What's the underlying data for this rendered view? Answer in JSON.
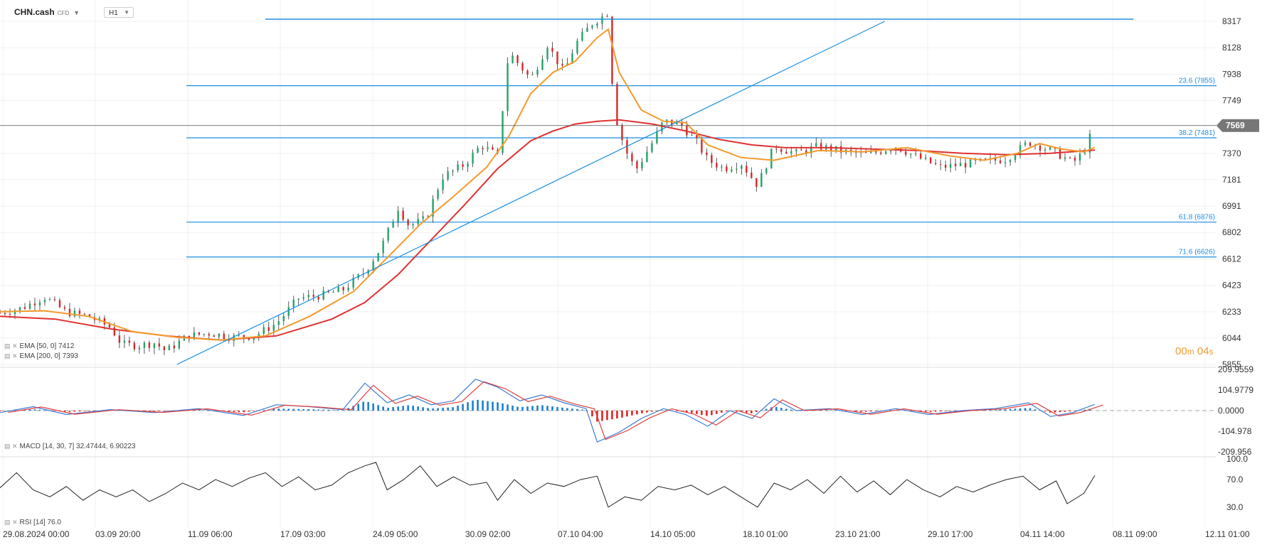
{
  "header": {
    "symbol": "CHN.cash",
    "symbol_type": "CFD",
    "timeframe": "H1"
  },
  "indicators": {
    "ema50_label": "EMA [50, 0] 7412",
    "ema200_label": "EMA [200, 0] 7393",
    "macd_label": "MACD [14, 30, 7] 32.47444, 6.90223",
    "rsi_label": "RSI [14] 76.0"
  },
  "timer": {
    "minutes": "00",
    "m": "m",
    "seconds": "04",
    "s": "s"
  },
  "colors": {
    "candle_up": "#26a269",
    "candle_down": "#d62828",
    "ema50": "#f39a2c",
    "ema200": "#e03131",
    "fib_line": "#1b8fe0",
    "macd_up": "#1b7fd1",
    "macd_down": "#e02525",
    "macd_line": "#3a7bd5",
    "signal_line": "#e04040",
    "rsi_line": "#222222",
    "price_tag": "#777777"
  },
  "chart_data": {
    "type": "candlestick",
    "current_price": 7569,
    "price_axis": {
      "ticks": [
        "8317",
        "8128",
        "7938",
        "7749",
        "7370",
        "7181",
        "6991",
        "6802",
        "6612",
        "6423",
        "6233",
        "6044",
        "5855"
      ],
      "range": [
        5855,
        8317
      ]
    },
    "time_axis": [
      "29.08.2024  00:00",
      "03.09  20:00",
      "11.09  06:00",
      "17.09  03:00",
      "24.09  05:00",
      "30.09  02:00",
      "07.10  04:00",
      "14.10  05:00",
      "18.10  01:00",
      "23.10  21:00",
      "29.10  17:00",
      "04.11  14:00",
      "08.11  09:00",
      "12.11  01:00"
    ],
    "fibonacci": [
      {
        "label": "23.6 (7855)",
        "value": 7855
      },
      {
        "label": "38.2 (7481)",
        "value": 7481
      },
      {
        "label": "61.8 (6876)",
        "value": 6876
      },
      {
        "label": "71.6 (6626)",
        "value": 6626
      }
    ],
    "price_path": [
      [
        0,
        6225
      ],
      [
        4,
        6260
      ],
      [
        8,
        6340
      ],
      [
        12,
        6230
      ],
      [
        16,
        6200
      ],
      [
        20,
        6120
      ],
      [
        22,
        6000
      ],
      [
        25,
        5990
      ],
      [
        28,
        6010
      ],
      [
        30,
        5950
      ],
      [
        34,
        6060
      ],
      [
        38,
        6080
      ],
      [
        42,
        6050
      ],
      [
        46,
        6060
      ],
      [
        50,
        6150
      ],
      [
        54,
        6330
      ],
      [
        58,
        6350
      ],
      [
        62,
        6390
      ],
      [
        66,
        6520
      ],
      [
        69,
        6700
      ],
      [
        72,
        6980
      ],
      [
        74,
        6850
      ],
      [
        77,
        6900
      ],
      [
        80,
        7200
      ],
      [
        84,
        7290
      ],
      [
        87,
        7430
      ],
      [
        90,
        7350
      ],
      [
        92,
        8100
      ],
      [
        96,
        7900
      ],
      [
        99,
        8150
      ],
      [
        102,
        7950
      ],
      [
        104,
        8150
      ],
      [
        107,
        8300
      ],
      [
        110,
        8380
      ],
      [
        111,
        7680
      ],
      [
        113,
        7400
      ],
      [
        115,
        7250
      ],
      [
        118,
        7450
      ],
      [
        120,
        7600
      ],
      [
        123,
        7580
      ],
      [
        126,
        7450
      ],
      [
        128,
        7320
      ],
      [
        131,
        7260
      ],
      [
        134,
        7300
      ],
      [
        137,
        7140
      ],
      [
        140,
        7420
      ],
      [
        144,
        7370
      ],
      [
        148,
        7420
      ],
      [
        153,
        7380
      ],
      [
        157,
        7360
      ],
      [
        162,
        7420
      ],
      [
        166,
        7340
      ],
      [
        170,
        7270
      ],
      [
        174,
        7290
      ],
      [
        178,
        7310
      ],
      [
        182,
        7330
      ],
      [
        186,
        7450
      ],
      [
        190,
        7390
      ],
      [
        192,
        7350
      ],
      [
        194,
        7300
      ],
      [
        196,
        7380
      ],
      [
        198,
        7569
      ]
    ],
    "ema50_path": [
      [
        0,
        6233
      ],
      [
        8,
        6240
      ],
      [
        16,
        6200
      ],
      [
        24,
        6090
      ],
      [
        32,
        6050
      ],
      [
        40,
        6030
      ],
      [
        48,
        6060
      ],
      [
        56,
        6200
      ],
      [
        64,
        6380
      ],
      [
        70,
        6620
      ],
      [
        76,
        6860
      ],
      [
        82,
        7060
      ],
      [
        88,
        7270
      ],
      [
        92,
        7490
      ],
      [
        96,
        7800
      ],
      [
        100,
        7950
      ],
      [
        104,
        8030
      ],
      [
        108,
        8200
      ],
      [
        110,
        8260
      ],
      [
        112,
        7950
      ],
      [
        116,
        7680
      ],
      [
        120,
        7600
      ],
      [
        124,
        7590
      ],
      [
        128,
        7430
      ],
      [
        134,
        7340
      ],
      [
        140,
        7320
      ],
      [
        148,
        7390
      ],
      [
        156,
        7380
      ],
      [
        164,
        7410
      ],
      [
        172,
        7350
      ],
      [
        178,
        7320
      ],
      [
        184,
        7370
      ],
      [
        188,
        7440
      ],
      [
        192,
        7400
      ],
      [
        196,
        7380
      ],
      [
        198,
        7412
      ]
    ],
    "ema200_path": [
      [
        0,
        6200
      ],
      [
        10,
        6180
      ],
      [
        20,
        6110
      ],
      [
        30,
        6060
      ],
      [
        40,
        6030
      ],
      [
        50,
        6060
      ],
      [
        60,
        6180
      ],
      [
        66,
        6300
      ],
      [
        72,
        6500
      ],
      [
        78,
        6750
      ],
      [
        84,
        7000
      ],
      [
        90,
        7260
      ],
      [
        96,
        7460
      ],
      [
        100,
        7530
      ],
      [
        104,
        7580
      ],
      [
        108,
        7600
      ],
      [
        112,
        7610
      ],
      [
        118,
        7580
      ],
      [
        124,
        7530
      ],
      [
        130,
        7470
      ],
      [
        136,
        7430
      ],
      [
        142,
        7410
      ],
      [
        150,
        7410
      ],
      [
        158,
        7400
      ],
      [
        166,
        7390
      ],
      [
        174,
        7370
      ],
      [
        182,
        7360
      ],
      [
        190,
        7370
      ],
      [
        198,
        7393
      ]
    ],
    "fan_line": {
      "from": [
        32,
        5855
      ],
      "to": [
        160,
        8317
      ]
    },
    "top_line": {
      "from": [
        48,
        8317
      ],
      "to": [
        205,
        8317
      ]
    },
    "macd_axis": {
      "ticks": [
        "209.9559",
        "104.9779",
        "0.0000",
        "-104.978",
        "-209.956"
      ],
      "range": [
        -209.956,
        209.9559
      ]
    },
    "macd_path": [
      [
        0,
        -10
      ],
      [
        6,
        20
      ],
      [
        12,
        -20
      ],
      [
        20,
        5
      ],
      [
        28,
        -10
      ],
      [
        36,
        10
      ],
      [
        44,
        -25
      ],
      [
        50,
        30
      ],
      [
        56,
        20
      ],
      [
        62,
        5
      ],
      [
        66,
        140
      ],
      [
        70,
        40
      ],
      [
        74,
        80
      ],
      [
        78,
        30
      ],
      [
        82,
        50
      ],
      [
        86,
        160
      ],
      [
        90,
        120
      ],
      [
        94,
        50
      ],
      [
        98,
        80
      ],
      [
        102,
        40
      ],
      [
        106,
        10
      ],
      [
        108,
        -160
      ],
      [
        112,
        -110
      ],
      [
        116,
        -40
      ],
      [
        120,
        10
      ],
      [
        124,
        -20
      ],
      [
        128,
        -80
      ],
      [
        132,
        0
      ],
      [
        136,
        -40
      ],
      [
        140,
        60
      ],
      [
        144,
        0
      ],
      [
        150,
        10
      ],
      [
        156,
        -20
      ],
      [
        162,
        10
      ],
      [
        168,
        -20
      ],
      [
        174,
        0
      ],
      [
        180,
        10
      ],
      [
        186,
        40
      ],
      [
        190,
        -30
      ],
      [
        194,
        -10
      ],
      [
        198,
        32
      ]
    ],
    "rsi_axis": {
      "ticks": [
        "100.0",
        "70.0",
        "30.0"
      ],
      "range": [
        0,
        100
      ]
    },
    "rsi_path": [
      [
        0,
        58
      ],
      [
        3,
        80
      ],
      [
        6,
        55
      ],
      [
        9,
        45
      ],
      [
        12,
        60
      ],
      [
        15,
        40
      ],
      [
        18,
        55
      ],
      [
        21,
        45
      ],
      [
        24,
        55
      ],
      [
        27,
        38
      ],
      [
        30,
        50
      ],
      [
        33,
        65
      ],
      [
        36,
        55
      ],
      [
        39,
        70
      ],
      [
        42,
        60
      ],
      [
        45,
        72
      ],
      [
        48,
        80
      ],
      [
        51,
        60
      ],
      [
        54,
        74
      ],
      [
        57,
        55
      ],
      [
        60,
        62
      ],
      [
        63,
        80
      ],
      [
        66,
        90
      ],
      [
        68,
        95
      ],
      [
        70,
        55
      ],
      [
        73,
        70
      ],
      [
        76,
        90
      ],
      [
        79,
        60
      ],
      [
        82,
        74
      ],
      [
        85,
        62
      ],
      [
        88,
        66
      ],
      [
        90,
        40
      ],
      [
        93,
        70
      ],
      [
        96,
        50
      ],
      [
        99,
        65
      ],
      [
        102,
        60
      ],
      [
        105,
        70
      ],
      [
        108,
        75
      ],
      [
        110,
        30
      ],
      [
        113,
        45
      ],
      [
        116,
        40
      ],
      [
        119,
        60
      ],
      [
        122,
        55
      ],
      [
        125,
        62
      ],
      [
        128,
        48
      ],
      [
        131,
        60
      ],
      [
        134,
        45
      ],
      [
        137,
        30
      ],
      [
        140,
        65
      ],
      [
        143,
        55
      ],
      [
        146,
        70
      ],
      [
        149,
        50
      ],
      [
        152,
        75
      ],
      [
        155,
        52
      ],
      [
        158,
        68
      ],
      [
        161,
        48
      ],
      [
        164,
        70
      ],
      [
        167,
        55
      ],
      [
        170,
        45
      ],
      [
        173,
        60
      ],
      [
        176,
        52
      ],
      [
        179,
        62
      ],
      [
        182,
        70
      ],
      [
        185,
        75
      ],
      [
        188,
        55
      ],
      [
        191,
        68
      ],
      [
        193,
        35
      ],
      [
        196,
        50
      ],
      [
        198,
        76
      ]
    ]
  }
}
